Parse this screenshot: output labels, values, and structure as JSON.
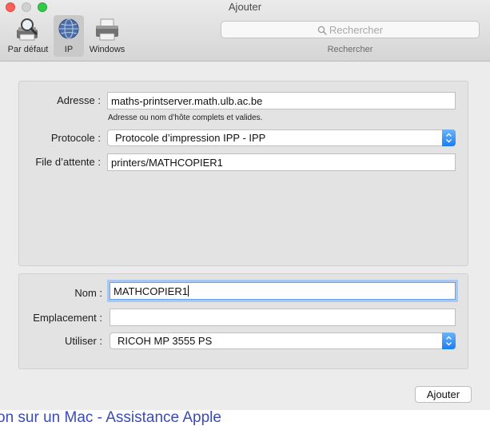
{
  "window": {
    "title": "Ajouter"
  },
  "toolbar": {
    "items": [
      {
        "label": "Par défaut",
        "icon": "default-printer-icon"
      },
      {
        "label": "IP",
        "icon": "globe-icon",
        "selected": true
      },
      {
        "label": "Windows",
        "icon": "windows-printer-icon"
      }
    ],
    "search": {
      "placeholder": "Rechercher",
      "caption": "Rechercher"
    }
  },
  "form": {
    "address": {
      "label": "Adresse :",
      "value": "maths-printserver.math.ulb.ac.be",
      "hint": "Adresse ou nom d’hôte complets et valides."
    },
    "protocol": {
      "label": "Protocole :",
      "value": "Protocole d’impression IPP - IPP"
    },
    "queue": {
      "label": "File d’attente :",
      "value": "printers/MATHCOPIER1"
    },
    "name": {
      "label": "Nom :",
      "value": "MATHCOPIER1"
    },
    "location": {
      "label": "Emplacement :",
      "value": ""
    },
    "use": {
      "label": "Utiliser :",
      "value": "RICOH MP 3555 PS"
    }
  },
  "footer": {
    "add_button": "Ajouter"
  },
  "background": {
    "text": "on sur un Mac - Assistance Apple"
  },
  "colors": {
    "accent": "#1a7ef3",
    "focus_ring": "#a9c8f1",
    "close": "#fc605b",
    "zoom": "#34c84a"
  }
}
